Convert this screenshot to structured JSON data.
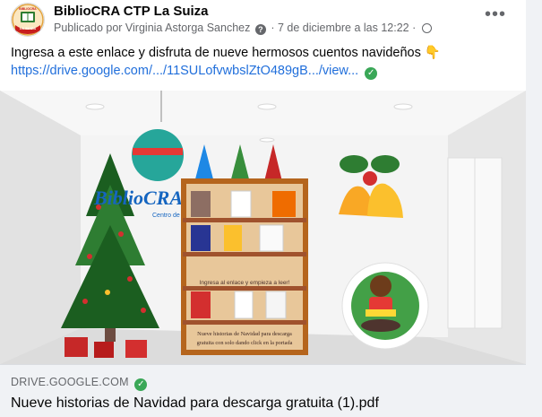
{
  "post": {
    "page_name": "BiblioCRA CTP La Suiza",
    "published_by": "Publicado por Virginia Astorga Sanchez",
    "timestamp": "7 de diciembre a las 12:22",
    "separator": "·",
    "text": "Ingresa a este enlace y disfruta de nueve hermosos cuentos navideños 👇",
    "link": "https://drive.google.com/.../11SULofvwbslZtO489gB.../view..."
  },
  "avatar": {
    "label": "LA SUIZA",
    "small": "BIBLIOCRA"
  },
  "image": {
    "logo": "BiblioCRA",
    "logo_sub": "Centro de Calidad",
    "bottom_caption_1": "Nueve historias de Navidad para descarga",
    "bottom_caption_2": "gratuita con solo dando click en la portada",
    "shelf_label": "Ingresa al enlace y empieza a leer!"
  },
  "link_preview": {
    "domain": "DRIVE.GOOGLE.COM",
    "title": "Nueve historias de Navidad para descarga gratuita (1).pdf"
  },
  "colors": {
    "link": "#216fdb",
    "verified": "#3aa757",
    "muted": "#65676b"
  },
  "icons": {
    "more": "more-horizontal-icon",
    "question": "question-icon",
    "globe": "globe-icon",
    "verified": "verified-check-icon"
  }
}
